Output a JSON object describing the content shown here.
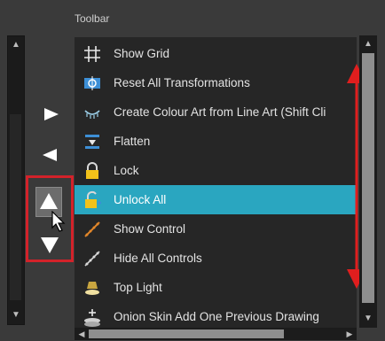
{
  "panel": {
    "title": "Toolbar"
  },
  "items": [
    {
      "label": "Show Grid",
      "icon": "grid-icon",
      "selected": false
    },
    {
      "label": "Reset All Transformations",
      "icon": "reset-transform-icon",
      "selected": false
    },
    {
      "label": "Create Colour Art from Line Art (Shift Cli",
      "icon": "colour-art-icon",
      "selected": false
    },
    {
      "label": "Flatten",
      "icon": "flatten-icon",
      "selected": false
    },
    {
      "label": "Lock",
      "icon": "lock-icon",
      "selected": false
    },
    {
      "label": "Unlock All",
      "icon": "unlock-icon",
      "selected": true
    },
    {
      "label": "Show Control",
      "icon": "show-control-icon",
      "selected": false
    },
    {
      "label": "Hide All Controls",
      "icon": "hide-controls-icon",
      "selected": false
    },
    {
      "label": "Top Light",
      "icon": "top-light-icon",
      "selected": false
    },
    {
      "label": "Onion Skin Add One Previous Drawing",
      "icon": "onion-skin-icon",
      "selected": false
    }
  ],
  "colors": {
    "selected_row": "#2aa6c0",
    "highlight": "#d3222a"
  }
}
